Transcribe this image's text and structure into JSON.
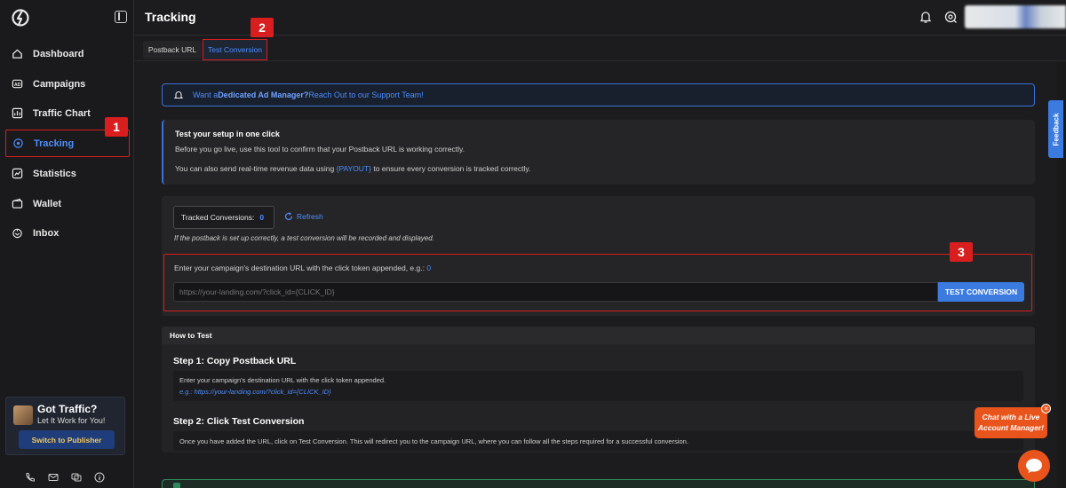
{
  "header": {
    "title": "Tracking"
  },
  "sidebar": {
    "items": [
      {
        "label": "Dashboard",
        "icon": "home-icon"
      },
      {
        "label": "Campaigns",
        "icon": "ad-icon"
      },
      {
        "label": "Traffic Chart",
        "icon": "chart-icon"
      },
      {
        "label": "Tracking",
        "icon": "target-icon",
        "active": true
      },
      {
        "label": "Statistics",
        "icon": "statistics-icon"
      },
      {
        "label": "Wallet",
        "icon": "wallet-icon"
      },
      {
        "label": "Inbox",
        "icon": "inbox-icon"
      }
    ],
    "promo": {
      "title": "Got Traffic?",
      "subtitle": "Let It Work for You!",
      "button": "Switch to Publisher"
    }
  },
  "tabs": [
    {
      "label": "Postback URL",
      "active": false
    },
    {
      "label": "Test Conversion",
      "active": true
    }
  ],
  "alert": {
    "prefix": "Want a ",
    "bold": "Dedicated Ad Manager?",
    "suffix": " Reach Out to our Support Team!"
  },
  "info": {
    "heading": "Test your setup in one click",
    "line1": "Before you go live, use this tool to confirm that your Postback URL is working correctly.",
    "line2_prefix": "You can also send real-time revenue data using ",
    "line2_token": "{PAYOUT}",
    "line2_suffix": " to ensure every conversion is tracked correctly."
  },
  "tracking": {
    "tracked_label": "Tracked Conversions:",
    "tracked_count": "0",
    "refresh_label": "Refresh",
    "note": "If the postback is set up correctly, a test conversion will be recorded and displayed.",
    "url_label": "Enter your campaign's destination URL with the click token appended, e.g.: ",
    "url_example": "0",
    "url_placeholder": "https://your-landing.com/?click_id={CLICK_ID}",
    "button": "TEST CONVERSION"
  },
  "howto": {
    "heading": "How to Test",
    "step1_title": "Step 1: Copy Postback URL",
    "step1_text": "Enter your campaign's destination URL with the click token appended.",
    "step1_eg": "e.g.: https://your-landing.com/?click_id={CLICK_ID}",
    "step2_title": "Step 2: Click Test Conversion",
    "step2_text": "Once you have added the URL, click on Test Conversion. This will redirect you to the campaign URL, where you can follow all the steps required for a successful conversion."
  },
  "feedback": "Feedback",
  "chat": {
    "bubble": "Chat with a Live Account Manager!"
  },
  "callouts": [
    "1",
    "2",
    "3"
  ],
  "colors": {
    "accent": "#4d8dff",
    "highlight": "#d81e1e",
    "chat": "#e8541c"
  }
}
